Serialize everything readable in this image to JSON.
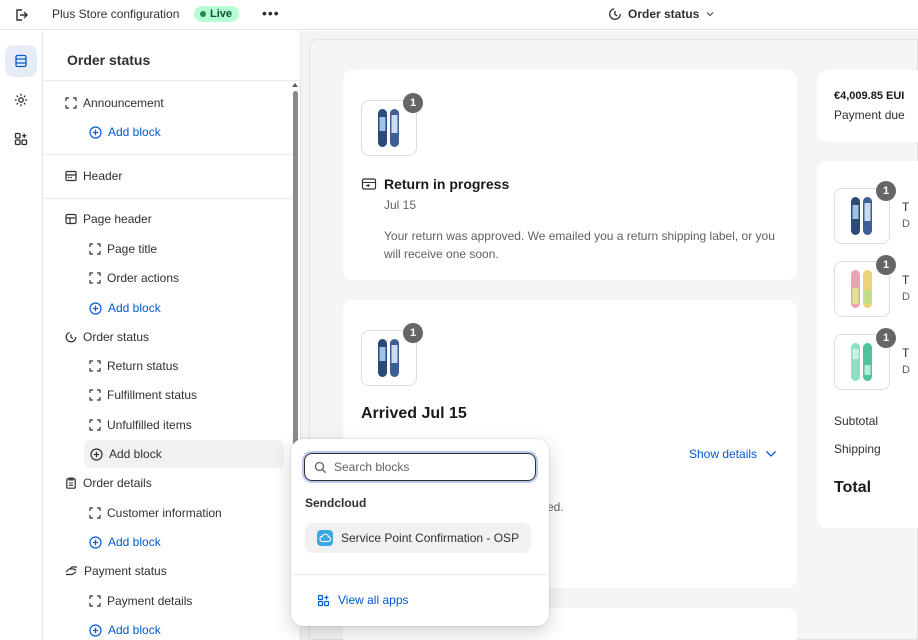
{
  "topbar": {
    "store_name": "Plus Store configuration",
    "live_label": "Live",
    "more_label": "•••",
    "page_selector": "Order status"
  },
  "sidebar": {
    "title": "Order status",
    "items": {
      "announcement": "Announcement",
      "announcement_add": "Add block",
      "header": "Header",
      "page_header": "Page header",
      "page_title": "Page title",
      "order_actions": "Order actions",
      "page_header_add": "Add block",
      "order_status": "Order status",
      "return_status": "Return status",
      "fulfillment_status": "Fulfillment status",
      "unfulfilled_items": "Unfulfilled items",
      "order_status_add": "Add block",
      "order_details": "Order details",
      "customer_information": "Customer information",
      "order_details_add": "Add block",
      "payment_status": "Payment status",
      "payment_details": "Payment details",
      "payment_status_add": "Add block"
    }
  },
  "preview": {
    "return_card": {
      "qty": "1",
      "title": "Return in progress",
      "date": "Jul 15",
      "message": "Your return was approved. We emailed you a return shipping label, or you will receive one soon."
    },
    "arrived_card": {
      "qty": "1",
      "title": "Arrived Jul 15",
      "show_details": "Show details",
      "partial_text": "ed."
    },
    "summary": {
      "amount": "€4,009.85 EUI",
      "payment_due": "Payment due ",
      "items": [
        {
          "qty": "1",
          "initial": "T",
          "sub": "D"
        },
        {
          "qty": "1",
          "initial": "T",
          "sub": "D"
        },
        {
          "qty": "1",
          "initial": "T",
          "sub": "D"
        }
      ],
      "subtotal_label": "Subtotal",
      "shipping_label": "Shipping",
      "total_label": "Total"
    }
  },
  "popover": {
    "search_placeholder": "Search blocks",
    "group_title": "Sendcloud",
    "option_label": "Service Point Confirmation - OSP",
    "view_all": "View all apps"
  },
  "colors": {
    "accent": "#005bd3",
    "live_bg": "#b4fed2",
    "live_text": "#0c5132"
  }
}
